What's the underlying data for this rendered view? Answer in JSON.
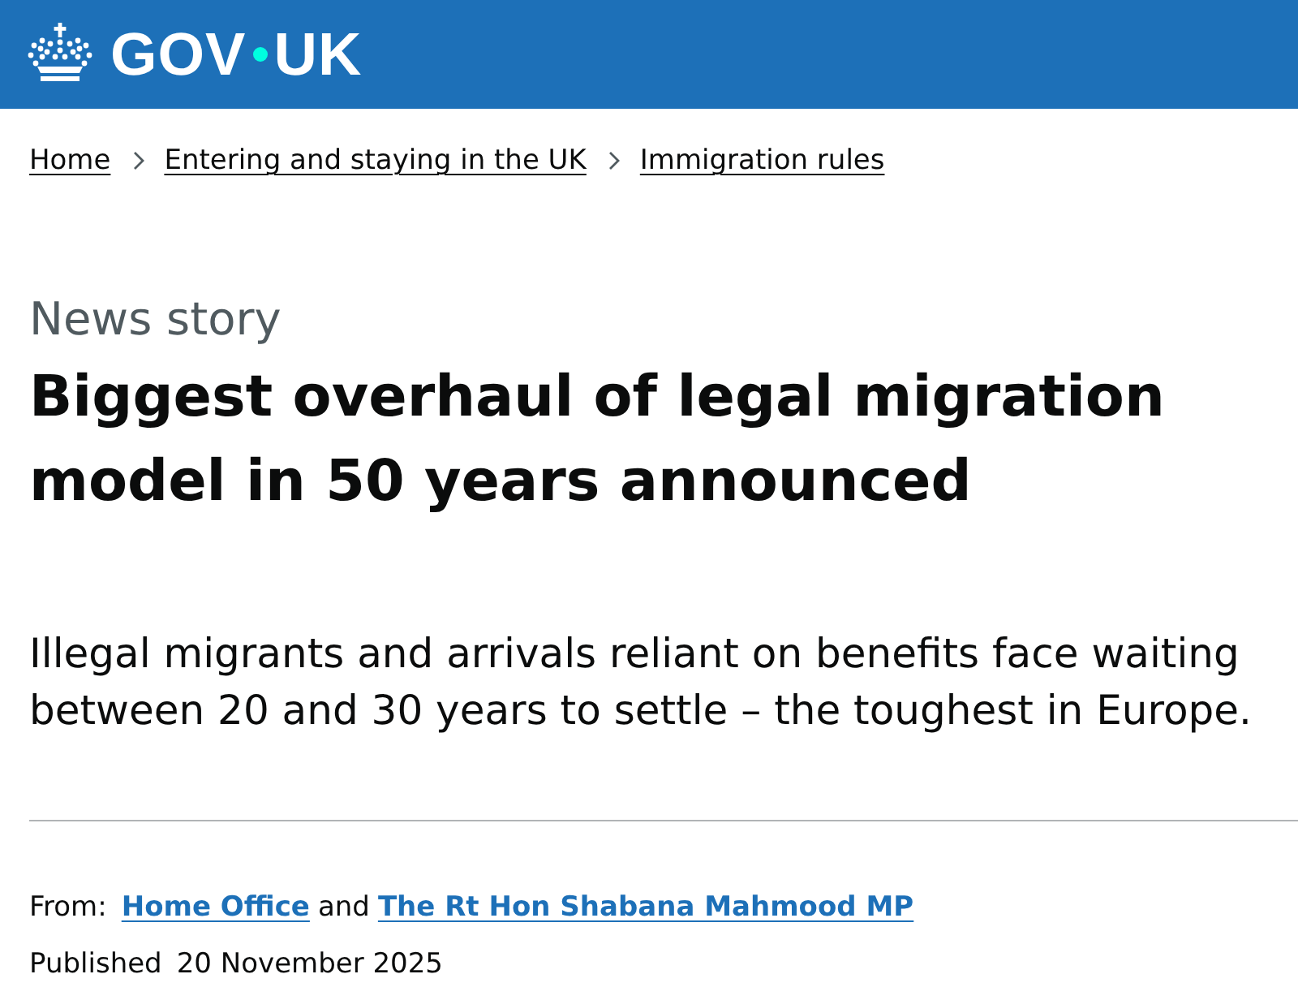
{
  "header": {
    "logo": {
      "parts": [
        "GOV",
        "UK"
      ]
    }
  },
  "breadcrumbs": [
    {
      "label": "Home"
    },
    {
      "label": "Entering and staying in the UK"
    },
    {
      "label": "Immigration rules"
    }
  ],
  "caption": "News story",
  "title": "Biggest overhaul of legal migration model in 50 years announced",
  "lead": "Illegal migrants and arrivals reliant on benefits face waiting between 20 and 30 years to settle – the toughest in Europe.",
  "metadata": {
    "from_label": "From:",
    "organisations": [
      "Home Office",
      "The Rt Hon Shabana Mahmood MP"
    ],
    "joiner": "and",
    "published_label": "Published",
    "published_date": "20 November 2025"
  }
}
